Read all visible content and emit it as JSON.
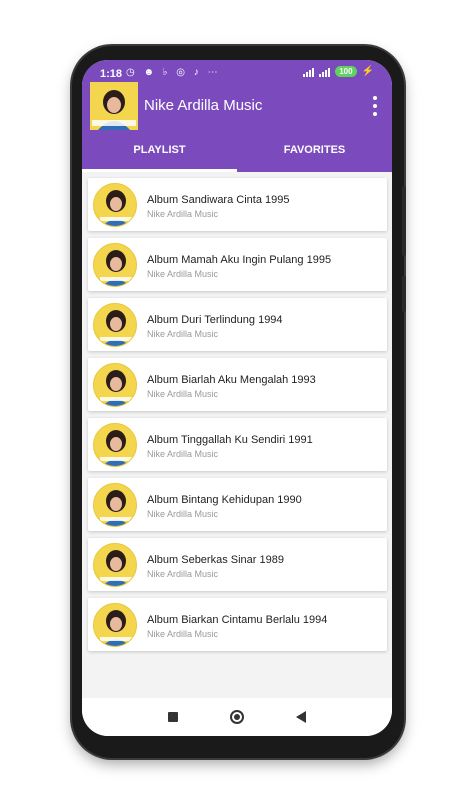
{
  "status": {
    "time": "1:18",
    "notif_icons": "◷ ☻ ♭ ◎ ♪ ⋯",
    "battery": "100",
    "battery_color": "#5ed35e"
  },
  "app": {
    "title": "Nike Ardilla Music",
    "accent": "#7b4bbd"
  },
  "tabs": [
    {
      "label": "PLAYLIST",
      "active": true
    },
    {
      "label": "FAVORITES",
      "active": false
    }
  ],
  "albums": [
    {
      "title": "Album Sandiwara Cinta 1995",
      "artist": "Nike Ardilla Music"
    },
    {
      "title": "Album Mamah Aku Ingin Pulang 1995",
      "artist": "Nike Ardilla Music"
    },
    {
      "title": "Album Duri Terlindung 1994",
      "artist": "Nike Ardilla Music"
    },
    {
      "title": "Album Biarlah Aku Mengalah 1993",
      "artist": "Nike Ardilla Music"
    },
    {
      "title": "Album Tinggallah Ku Sendiri 1991",
      "artist": "Nike Ardilla Music"
    },
    {
      "title": "Album Bintang Kehidupan 1990",
      "artist": "Nike Ardilla Music"
    },
    {
      "title": "Album Seberkas Sinar 1989",
      "artist": "Nike Ardilla Music"
    },
    {
      "title": "Album Biarkan Cintamu Berlalu 1994",
      "artist": "Nike Ardilla Music"
    }
  ]
}
